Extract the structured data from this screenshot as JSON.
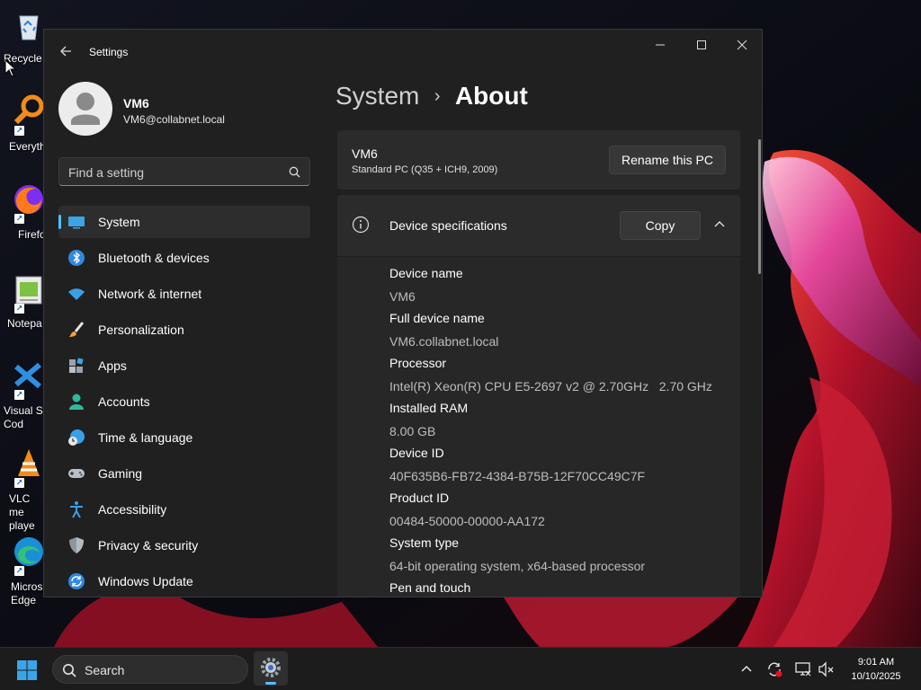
{
  "desktop": {
    "icons": [
      {
        "label": "Recycle",
        "icon": "recycle-bin-icon"
      },
      {
        "label": "Everyth",
        "icon": "everything-search-icon"
      },
      {
        "label": "Firefo",
        "icon": "firefox-icon"
      },
      {
        "label": "Notepa",
        "icon": "notepad-icon"
      },
      {
        "label": "Visual St Cod",
        "icon": "vscode-icon"
      },
      {
        "label": "VLC me playe",
        "icon": "vlc-icon"
      },
      {
        "label": "Micros Edge",
        "icon": "edge-icon"
      }
    ]
  },
  "window": {
    "title": "Settings",
    "colors": {
      "accent": "#4cc2ff",
      "background": "#202020",
      "card": "#2b2b2b"
    }
  },
  "profile": {
    "name": "VM6",
    "email": "VM6@collabnet.local"
  },
  "search": {
    "placeholder": "Find a setting"
  },
  "nav": {
    "items": [
      {
        "label": "System",
        "icon": "system-icon",
        "active": true
      },
      {
        "label": "Bluetooth & devices",
        "icon": "bluetooth-icon"
      },
      {
        "label": "Network & internet",
        "icon": "network-icon"
      },
      {
        "label": "Personalization",
        "icon": "brush-icon"
      },
      {
        "label": "Apps",
        "icon": "apps-icon"
      },
      {
        "label": "Accounts",
        "icon": "accounts-icon"
      },
      {
        "label": "Time & language",
        "icon": "time-language-icon"
      },
      {
        "label": "Gaming",
        "icon": "gaming-icon"
      },
      {
        "label": "Accessibility",
        "icon": "accessibility-icon"
      },
      {
        "label": "Privacy & security",
        "icon": "shield-icon"
      },
      {
        "label": "Windows Update",
        "icon": "update-icon"
      }
    ]
  },
  "breadcrumb": {
    "parent": "System",
    "separator": "›",
    "current": "About"
  },
  "pc_card": {
    "name": "VM6",
    "model": "Standard PC (Q35 + ICH9, 2009)",
    "rename_label": "Rename this PC"
  },
  "device_specs": {
    "title": "Device specifications",
    "copy_label": "Copy",
    "rows": [
      {
        "label": "Device name",
        "value": "VM6"
      },
      {
        "label": "Full device name",
        "value": "VM6.collabnet.local"
      },
      {
        "label": "Processor",
        "value": "Intel(R) Xeon(R) CPU E5-2697 v2 @ 2.70GHz   2.70 GHz"
      },
      {
        "label": "Installed RAM",
        "value": "8.00 GB"
      },
      {
        "label": "Device ID",
        "value": "40F635B6-FB72-4384-B75B-12F70CC49C7F"
      },
      {
        "label": "Product ID",
        "value": "00484-50000-00000-AA172"
      },
      {
        "label": "System type",
        "value": "64-bit operating system, x64-based processor"
      },
      {
        "label": "Pen and touch",
        "value": ""
      }
    ]
  },
  "taskbar": {
    "search_label": "Search",
    "time": "9:01 AM",
    "date": "10/10/2025"
  }
}
